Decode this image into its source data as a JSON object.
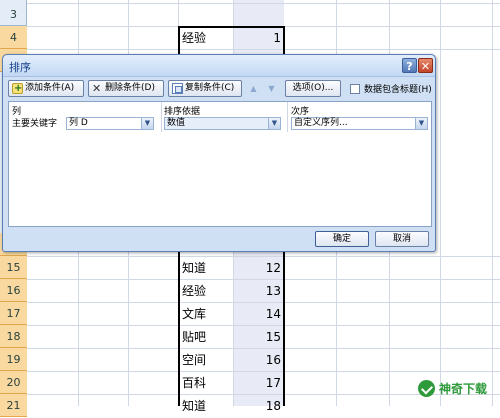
{
  "sheet": {
    "rows": [
      {
        "n": "3",
        "text": "",
        "num": ""
      },
      {
        "n": "4",
        "text": "经验",
        "num": "1"
      },
      {
        "n": "15",
        "text": "知道",
        "num": "12"
      },
      {
        "n": "16",
        "text": "经验",
        "num": "13"
      },
      {
        "n": "17",
        "text": "文库",
        "num": "14"
      },
      {
        "n": "18",
        "text": "贴吧",
        "num": "15"
      },
      {
        "n": "19",
        "text": "空间",
        "num": "16"
      },
      {
        "n": "20",
        "text": "百科",
        "num": "17"
      },
      {
        "n": "21",
        "text": "知道",
        "num": "18"
      }
    ]
  },
  "dialog": {
    "title": "排序",
    "help_glyph": "?",
    "close_glyph": "✕",
    "toolbar": {
      "add_label": "添加条件(A)",
      "delete_label": "删除条件(D)",
      "copy_label": "复制条件(C)",
      "move_up_glyph": "▲",
      "move_down_glyph": "▼",
      "options_label": "选项(O)...",
      "header_checkbox_label": "数据包含标题(H)"
    },
    "grid": {
      "col_header": "列",
      "sort_on_header": "排序依据",
      "order_header": "次序",
      "row_label": "主要关键字",
      "column_value": "列 D",
      "sort_on_value": "数值",
      "order_value": "自定义序列..."
    },
    "ok_label": "确定",
    "cancel_label": "取消"
  },
  "watermark": {
    "text": "神奇下载"
  },
  "colors": {
    "dialog_bg": "#cfe0f5",
    "title_text": "#15428b",
    "selected_col": "#e8ebf5",
    "row_header_sel": "#f9d99f"
  }
}
